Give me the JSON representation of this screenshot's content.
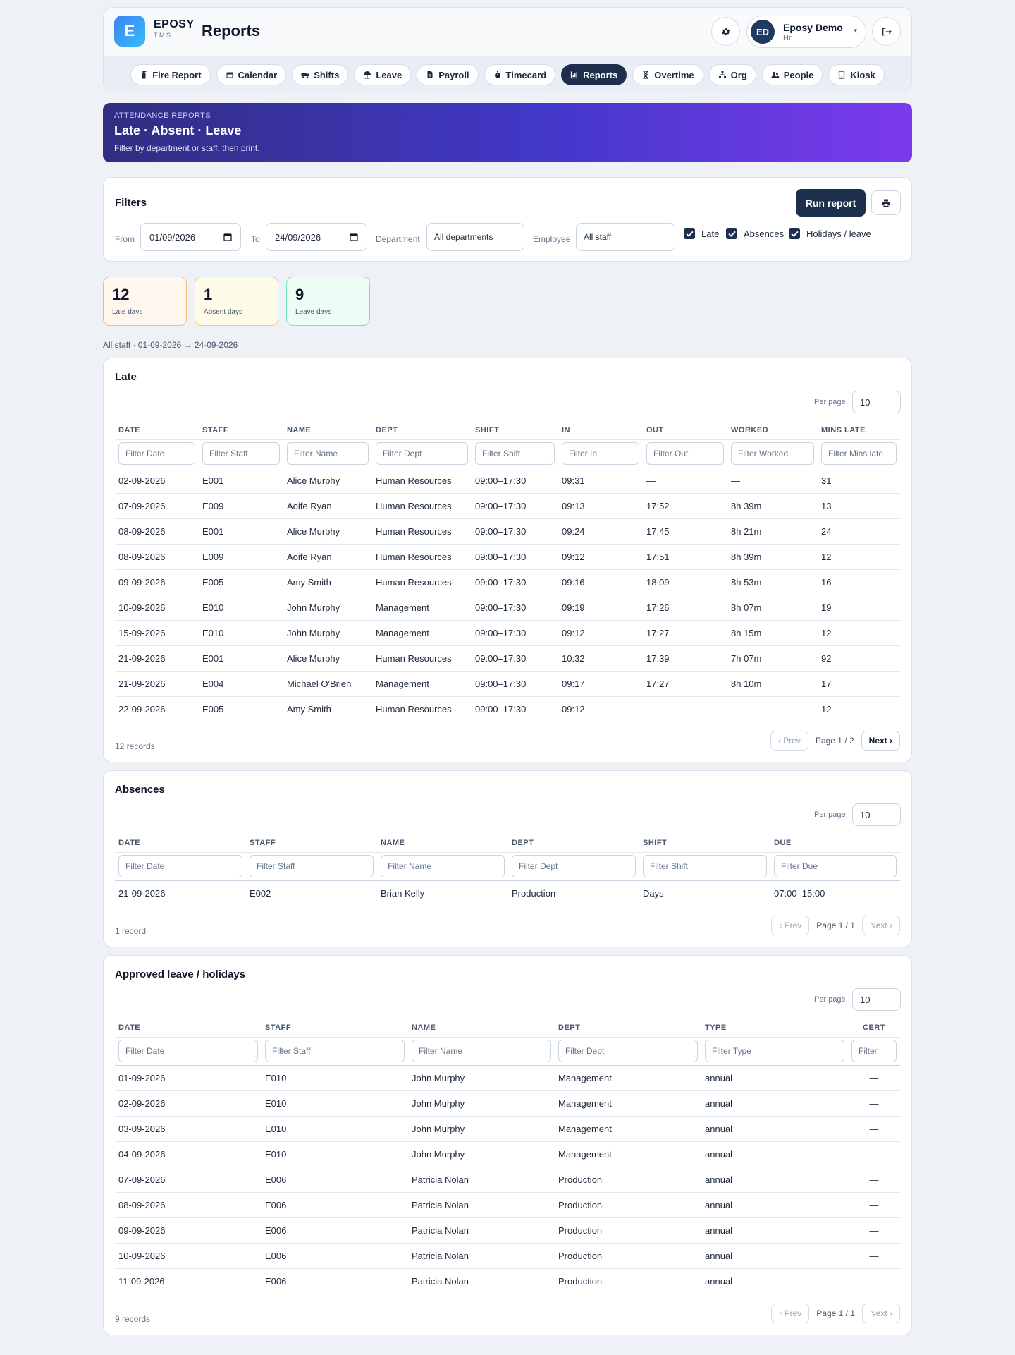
{
  "header": {
    "logo_letter": "E",
    "brand": "EPOSY",
    "brand_sub": "TMS",
    "page_title": "Reports",
    "user": {
      "initials": "ED",
      "name": "Eposy Demo",
      "role": "Hr",
      "caret": "▾"
    },
    "nav": [
      {
        "label": "Fire Report",
        "icon": "fire-extinguisher-icon"
      },
      {
        "label": "Calendar",
        "icon": "calendar-icon"
      },
      {
        "label": "Shifts",
        "icon": "truck-icon"
      },
      {
        "label": "Leave",
        "icon": "umbrella-beach-icon"
      },
      {
        "label": "Payroll",
        "icon": "file-invoice-icon"
      },
      {
        "label": "Timecard",
        "icon": "stopwatch-icon"
      },
      {
        "label": "Reports",
        "icon": "chart-icon",
        "active": true
      },
      {
        "label": "Overtime",
        "icon": "hourglass-icon"
      },
      {
        "label": "Org",
        "icon": "sitemap-icon"
      },
      {
        "label": "People",
        "icon": "users-icon"
      },
      {
        "label": "Kiosk",
        "icon": "tablet-icon"
      }
    ]
  },
  "banner": {
    "eyebrow": "ATTENDANCE REPORTS",
    "title": "Late · Absent · Leave",
    "subtitle": "Filter by department or staff, then print."
  },
  "filters": {
    "title": "Filters",
    "run_label": "Run report",
    "print_icon": "print-icon",
    "from_label": "From",
    "from_value": "01/09/2026",
    "to_label": "To",
    "to_value": "24/09/2026",
    "department_label": "Department",
    "department_value": "All departments",
    "employee_label": "Employee",
    "employee_value": "All staff",
    "checks": [
      {
        "label": "Late",
        "checked": true
      },
      {
        "label": "Absences",
        "checked": true
      },
      {
        "label": "Holidays / leave",
        "checked": true
      }
    ]
  },
  "stats": [
    {
      "value": "12",
      "label": "Late days",
      "bg": "#fff7ed",
      "border": "#fdba74"
    },
    {
      "value": "1",
      "label": "Absent days",
      "bg": "#fefce8",
      "border": "#fcd34d"
    },
    {
      "value": "9",
      "label": "Leave days",
      "bg": "#ecfdf5",
      "border": "#6ee7b7"
    }
  ],
  "scope_text": "All staff · 01-09-2026 → 24-09-2026",
  "per_page_label": "Per page",
  "late": {
    "title": "Late",
    "per_page": "10",
    "columns": [
      "DATE",
      "STAFF",
      "NAME",
      "DEPT",
      "SHIFT",
      "IN",
      "OUT",
      "WORKED",
      "MINS LATE"
    ],
    "filters": [
      "Filter Date",
      "Filter Staff",
      "Filter Name",
      "Filter Dept",
      "Filter Shift",
      "Filter In",
      "Filter Out",
      "Filter Worked",
      "Filter Mins late"
    ],
    "rows": [
      [
        "02-09-2026",
        "E001",
        "Alice Murphy",
        "Human Resources",
        "09:00–17:30",
        "09:31",
        "—",
        "—",
        "31"
      ],
      [
        "07-09-2026",
        "E009",
        "Aoife Ryan",
        "Human Resources",
        "09:00–17:30",
        "09:13",
        "17:52",
        "8h 39m",
        "13"
      ],
      [
        "08-09-2026",
        "E001",
        "Alice Murphy",
        "Human Resources",
        "09:00–17:30",
        "09:24",
        "17:45",
        "8h 21m",
        "24"
      ],
      [
        "08-09-2026",
        "E009",
        "Aoife Ryan",
        "Human Resources",
        "09:00–17:30",
        "09:12",
        "17:51",
        "8h 39m",
        "12"
      ],
      [
        "09-09-2026",
        "E005",
        "Amy Smith",
        "Human Resources",
        "09:00–17:30",
        "09:16",
        "18:09",
        "8h 53m",
        "16"
      ],
      [
        "10-09-2026",
        "E010",
        "John Murphy",
        "Management",
        "09:00–17:30",
        "09:19",
        "17:26",
        "8h 07m",
        "19"
      ],
      [
        "15-09-2026",
        "E010",
        "John Murphy",
        "Management",
        "09:00–17:30",
        "09:12",
        "17:27",
        "8h 15m",
        "12"
      ],
      [
        "21-09-2026",
        "E001",
        "Alice Murphy",
        "Human Resources",
        "09:00–17:30",
        "10:32",
        "17:39",
        "7h 07m",
        "92"
      ],
      [
        "21-09-2026",
        "E004",
        "Michael O'Brien",
        "Management",
        "09:00–17:30",
        "09:17",
        "17:27",
        "8h 10m",
        "17"
      ],
      [
        "22-09-2026",
        "E005",
        "Amy Smith",
        "Human Resources",
        "09:00–17:30",
        "09:12",
        "—",
        "—",
        "12"
      ]
    ],
    "records": "12 records",
    "prev": "‹ Prev",
    "page": "Page 1 / 2",
    "next": "Next ›"
  },
  "absences": {
    "title": "Absences",
    "per_page": "10",
    "columns": [
      "DATE",
      "STAFF",
      "NAME",
      "DEPT",
      "SHIFT",
      "DUE"
    ],
    "filters": [
      "Filter Date",
      "Filter Staff",
      "Filter Name",
      "Filter Dept",
      "Filter Shift",
      "Filter Due"
    ],
    "rows": [
      [
        "21-09-2026",
        "E002",
        "Brian Kelly",
        "Production",
        "Days",
        "07:00–15:00"
      ]
    ],
    "records": "1 record",
    "prev": "‹ Prev",
    "page": "Page 1 / 1",
    "next": "Next ›"
  },
  "leave": {
    "title": "Approved leave / holidays",
    "per_page": "10",
    "columns": [
      "DATE",
      "STAFF",
      "NAME",
      "DEPT",
      "TYPE",
      "CERT"
    ],
    "filters": [
      "Filter Date",
      "Filter Staff",
      "Filter Name",
      "Filter Dept",
      "Filter Type",
      "Filter"
    ],
    "rows": [
      [
        "01-09-2026",
        "E010",
        "John Murphy",
        "Management",
        "annual",
        "—"
      ],
      [
        "02-09-2026",
        "E010",
        "John Murphy",
        "Management",
        "annual",
        "—"
      ],
      [
        "03-09-2026",
        "E010",
        "John Murphy",
        "Management",
        "annual",
        "—"
      ],
      [
        "04-09-2026",
        "E010",
        "John Murphy",
        "Management",
        "annual",
        "—"
      ],
      [
        "07-09-2026",
        "E006",
        "Patricia Nolan",
        "Production",
        "annual",
        "—"
      ],
      [
        "08-09-2026",
        "E006",
        "Patricia Nolan",
        "Production",
        "annual",
        "—"
      ],
      [
        "09-09-2026",
        "E006",
        "Patricia Nolan",
        "Production",
        "annual",
        "—"
      ],
      [
        "10-09-2026",
        "E006",
        "Patricia Nolan",
        "Production",
        "annual",
        "—"
      ],
      [
        "11-09-2026",
        "E006",
        "Patricia Nolan",
        "Production",
        "annual",
        "—"
      ]
    ],
    "records": "9 records",
    "prev": "‹ Prev",
    "page": "Page 1 / 1",
    "next": "Next ›"
  }
}
